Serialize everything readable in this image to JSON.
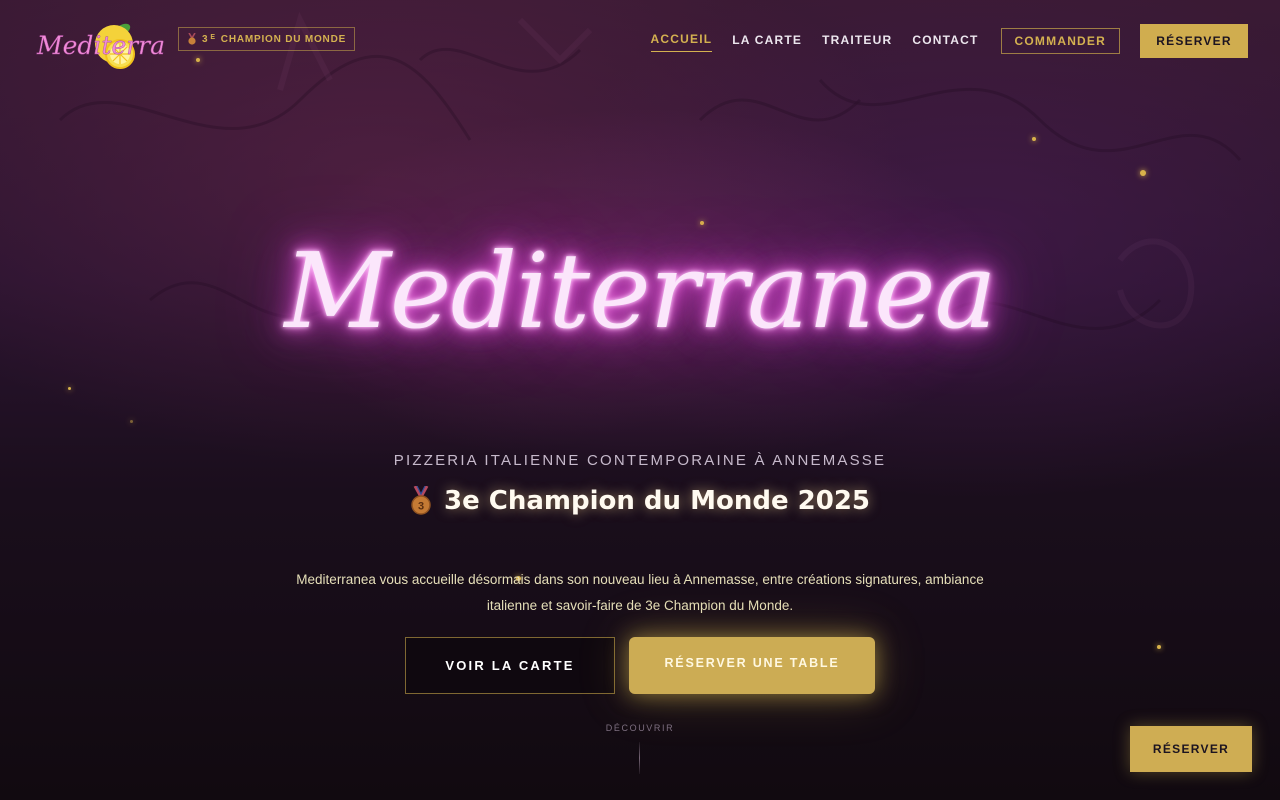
{
  "brand": {
    "logo_text": "Mediterranea",
    "logo_icon": "lemon-icon"
  },
  "header": {
    "badge_icon": "medal-icon",
    "badge_rank": "3",
    "badge_rank_suffix": "E",
    "badge_text": "CHAMPION DU MONDE",
    "nav": [
      {
        "label": "ACCUEIL",
        "active": true
      },
      {
        "label": "LA CARTE",
        "active": false
      },
      {
        "label": "TRAITEUR",
        "active": false
      },
      {
        "label": "CONTACT",
        "active": false
      }
    ],
    "commander_label": "COMMANDER",
    "reserver_label": "RÉSERVER"
  },
  "hero": {
    "neon_title": "Mediterranea",
    "subtitle": "PIZZERIA ITALIENNE CONTEMPORAINE À ANNEMASSE",
    "champion_icon": "medal-icon",
    "champion_heading": "3e Champion du Monde 2025",
    "description": "Mediterranea vous accueille désormais dans son nouveau lieu à Annemasse, entre créations signatures, ambiance italienne et savoir-faire de 3e Champion du Monde.",
    "btn_carte": "VOIR LA CARTE",
    "btn_table": "RÉSERVER UNE TABLE",
    "discover": "DÉCOUVRIR"
  },
  "floating": {
    "reserver_label": "RÉSERVER"
  },
  "colors": {
    "gold": "#d0ad4f",
    "neon_pink": "#ec56e0",
    "background": "#1a0e1c"
  }
}
